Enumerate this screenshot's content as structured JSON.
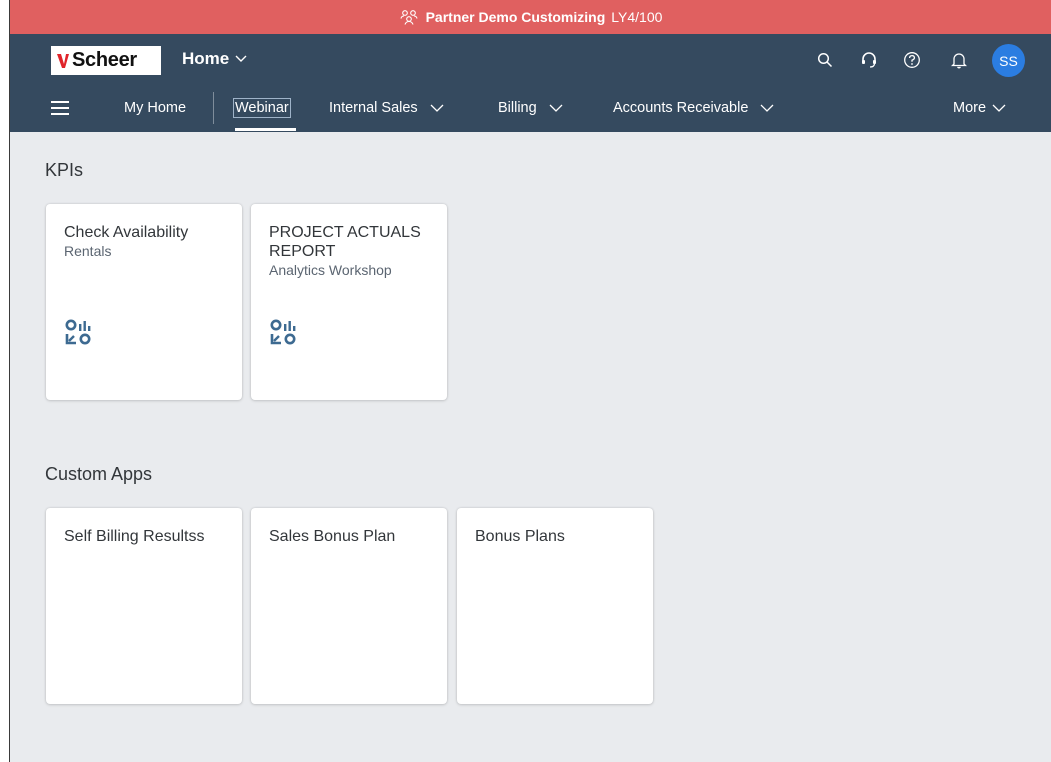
{
  "banner": {
    "title": "Partner Demo Customizing",
    "system_id": "LY4/100",
    "icon": "people-group-icon",
    "color": "#e06060"
  },
  "shell": {
    "logo_text": "Scheer",
    "home_title": "Home",
    "avatar_initials": "SS",
    "avatar_color": "#2b7de1",
    "background": "#354a5f",
    "icons": [
      "search-icon",
      "headset-icon",
      "help-icon",
      "bell-icon"
    ]
  },
  "nav": {
    "items": [
      {
        "label": "My Home"
      },
      {
        "label": "Webinar",
        "active": true
      },
      {
        "label": "Internal Sales",
        "has_dropdown": true
      },
      {
        "label": "Billing",
        "has_dropdown": true
      },
      {
        "label": "Accounts Receivable",
        "has_dropdown": true
      },
      {
        "label": "More",
        "has_dropdown": true
      }
    ]
  },
  "sections": [
    {
      "title": "KPIs",
      "tiles": [
        {
          "title": "Check Availability",
          "subtitle": "Rentals",
          "icon": "analytics-kpi-icon"
        },
        {
          "title": "PROJECT ACTUALS REPORT",
          "subtitle": "Analytics Workshop",
          "icon": "analytics-kpi-icon"
        }
      ]
    },
    {
      "title": "Custom Apps",
      "tiles": [
        {
          "title": "Self Billing Resultss"
        },
        {
          "title": "Sales Bonus Plan"
        },
        {
          "title": "Bonus Plans"
        }
      ]
    }
  ],
  "colors": {
    "page_background": "#e9ebee",
    "tile_background": "#ffffff",
    "icon_blue": "#3d6a91"
  }
}
